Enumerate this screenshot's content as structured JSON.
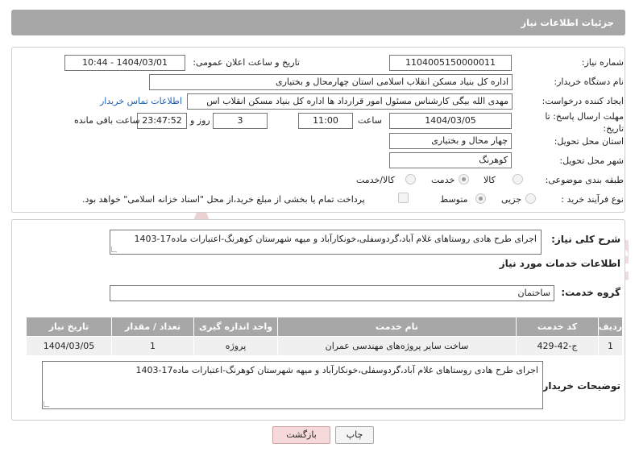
{
  "header": {
    "title": "جزئیات اطلاعات نیاز"
  },
  "form": {
    "need_number": {
      "label": "شماره نیاز:",
      "value": "1104005150000011"
    },
    "announce": {
      "label": "تاریخ و ساعت اعلان عمومی:",
      "value": "1404/03/01 - 10:44"
    },
    "buyer_org": {
      "label": "نام دستگاه خریدار:",
      "value": "اداره کل بنیاد مسکن انقلاب اسلامی استان چهارمحال و بختیاری"
    },
    "requester": {
      "label": "ایجاد کننده درخواست:",
      "value": "مهدی الله بیگی کارشناس مسئول امور قرارداد ها اداره کل بنیاد مسکن انقلاب اس",
      "link": "اطلاعات تماس خریدار"
    },
    "deadline": {
      "label": "مهلت ارسال پاسخ: تا تاریخ:",
      "date": "1404/03/05",
      "time_label": "ساعت",
      "time": "11:00",
      "days": "3",
      "days_label": "روز و",
      "remaining": "23:47:52",
      "remaining_label": "ساعت باقی مانده"
    },
    "province": {
      "label": "استان محل تحویل:",
      "value": "چهار محال و بختیاری"
    },
    "city": {
      "label": "شهر محل تحویل:",
      "value": "کوهرنگ"
    },
    "category": {
      "label": "طبقه بندی موضوعی:",
      "options": [
        "کالا",
        "خدمت",
        "کالا/خدمت"
      ],
      "selected": "خدمت"
    },
    "process": {
      "label": "نوع فرآیند خرید :",
      "options": [
        "جزیی",
        "متوسط"
      ],
      "selected": "متوسط",
      "payment_note": "پرداخت تمام یا بخشی از مبلغ خرید،از محل \"اسناد خزانه اسلامی\" خواهد بود."
    }
  },
  "summary": {
    "label": "شرح کلی نیاز:",
    "value": "اجرای طرح هادی روستاهای غلام آباد،گردوسفلی،خونکارآباد و میهه شهرستان کوهرنگ-اعتبارات ماده17-1403"
  },
  "services": {
    "title": "اطلاعات خدمات مورد نیاز",
    "group_label": "گروه خدمت:",
    "group_value": "ساختمان",
    "columns": [
      "ردیف",
      "کد خدمت",
      "نام خدمت",
      "واحد اندازه گیری",
      "تعداد / مقدار",
      "تاریخ نیاز"
    ],
    "rows": [
      [
        "1",
        "ج-42-429",
        "ساخت سایر پروژه‌های مهندسی عمران",
        "پروژه",
        "1",
        "1404/03/05"
      ]
    ]
  },
  "buyer_notes": {
    "label": "توضیحات خریدار:",
    "value": "اجرای طرح هادی روستاهای غلام آباد،گردوسفلی،خونکارآباد و میهه شهرستان کوهرنگ-اعتبارات ماده17-1403"
  },
  "buttons": {
    "print": "چاپ",
    "back": "بازگشت"
  },
  "watermark": {
    "text": "AriaTender.neT"
  },
  "colors": {
    "header_bg": "#a7a7a7",
    "link": "#1f5fb3",
    "back_button": "#f6dada",
    "watermark": "#e7c9c9"
  }
}
